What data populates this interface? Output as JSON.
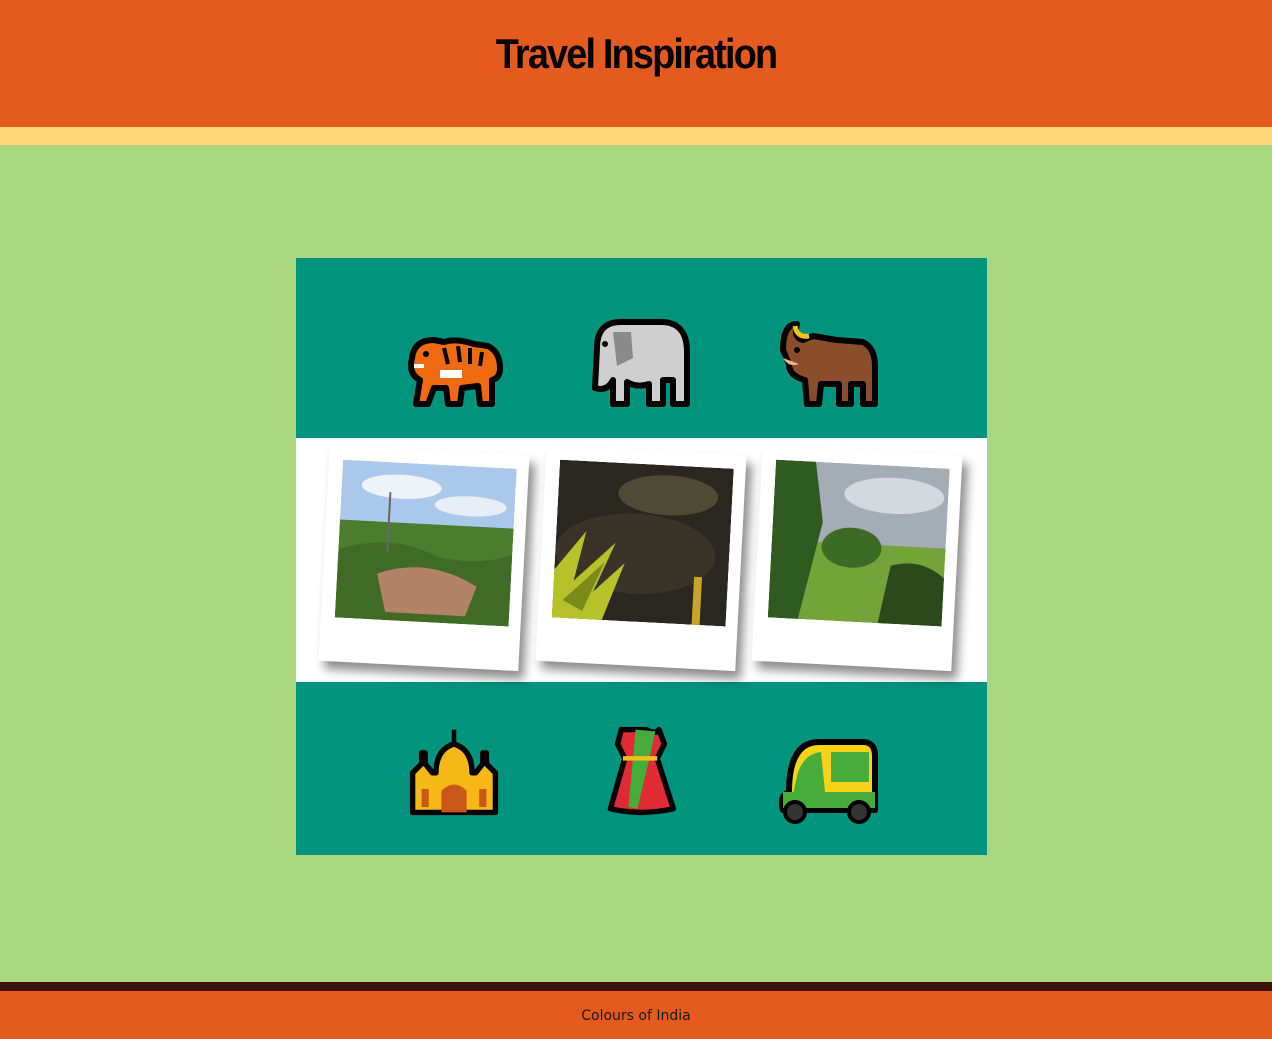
{
  "header": {
    "title": "Travel Inspiration"
  },
  "icons_top": [
    {
      "name": "tiger-icon"
    },
    {
      "name": "elephant-icon"
    },
    {
      "name": "ox-icon"
    }
  ],
  "photos": [
    {
      "name": "park-photo"
    },
    {
      "name": "cafe-plant-photo"
    },
    {
      "name": "paddy-field-photo"
    }
  ],
  "icons_bottom": [
    {
      "name": "hindu-temple-icon"
    },
    {
      "name": "sari-icon"
    },
    {
      "name": "auto-rickshaw-icon"
    }
  ],
  "colors": {
    "header": "#e55b1f",
    "stripe": "#ffd67a",
    "background": "#a8d780",
    "panel": "#00937d",
    "footer_line": "#3a1406"
  },
  "footer": {
    "text": "Colours of India"
  }
}
